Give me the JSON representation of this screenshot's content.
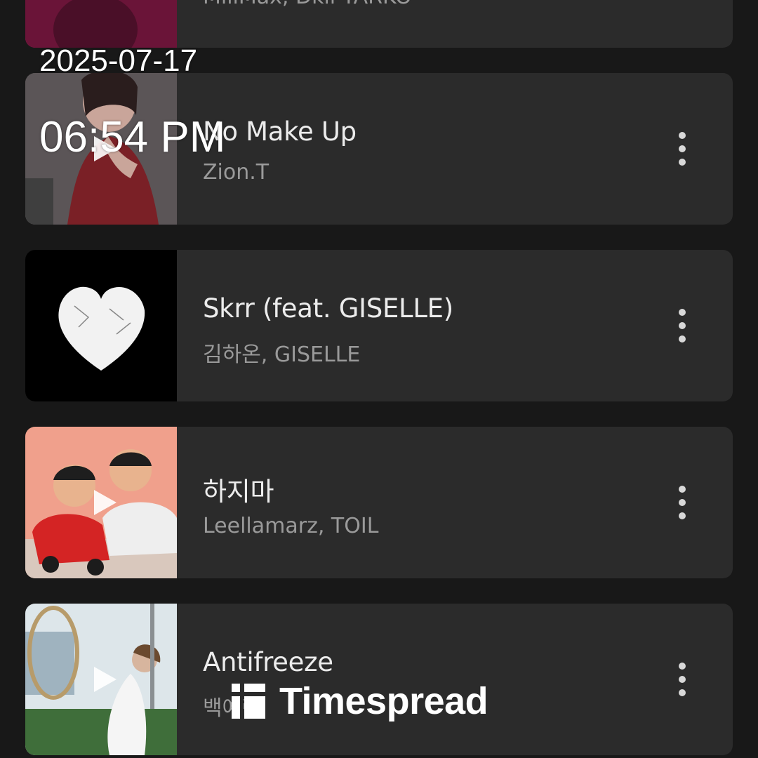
{
  "tracks": [
    {
      "title": "",
      "artist": "MiiiMax, Dkii TARKO",
      "more_icon": "more-vertical-icon"
    },
    {
      "title": "No Make Up",
      "artist": "Zion.T",
      "more_icon": "more-vertical-icon"
    },
    {
      "title": "Skrr (feat. GISELLE)",
      "artist": "김하온, GISELLE",
      "more_icon": "more-vertical-icon"
    },
    {
      "title": "하지마",
      "artist": "Leellamarz, TOIL",
      "more_icon": "more-vertical-icon"
    },
    {
      "title": "Antifreeze",
      "artist": "백예린",
      "more_icon": "more-vertical-icon"
    }
  ],
  "overlay": {
    "date": "2025-07-17",
    "time": "06:54 PM"
  },
  "watermark": {
    "text": "Timespread",
    "icon": "timespread-logo-icon"
  },
  "colors": {
    "background": "#181818",
    "card": "#2b2b2b",
    "title_text": "#ececec",
    "artist_text": "#9a9a9a"
  }
}
